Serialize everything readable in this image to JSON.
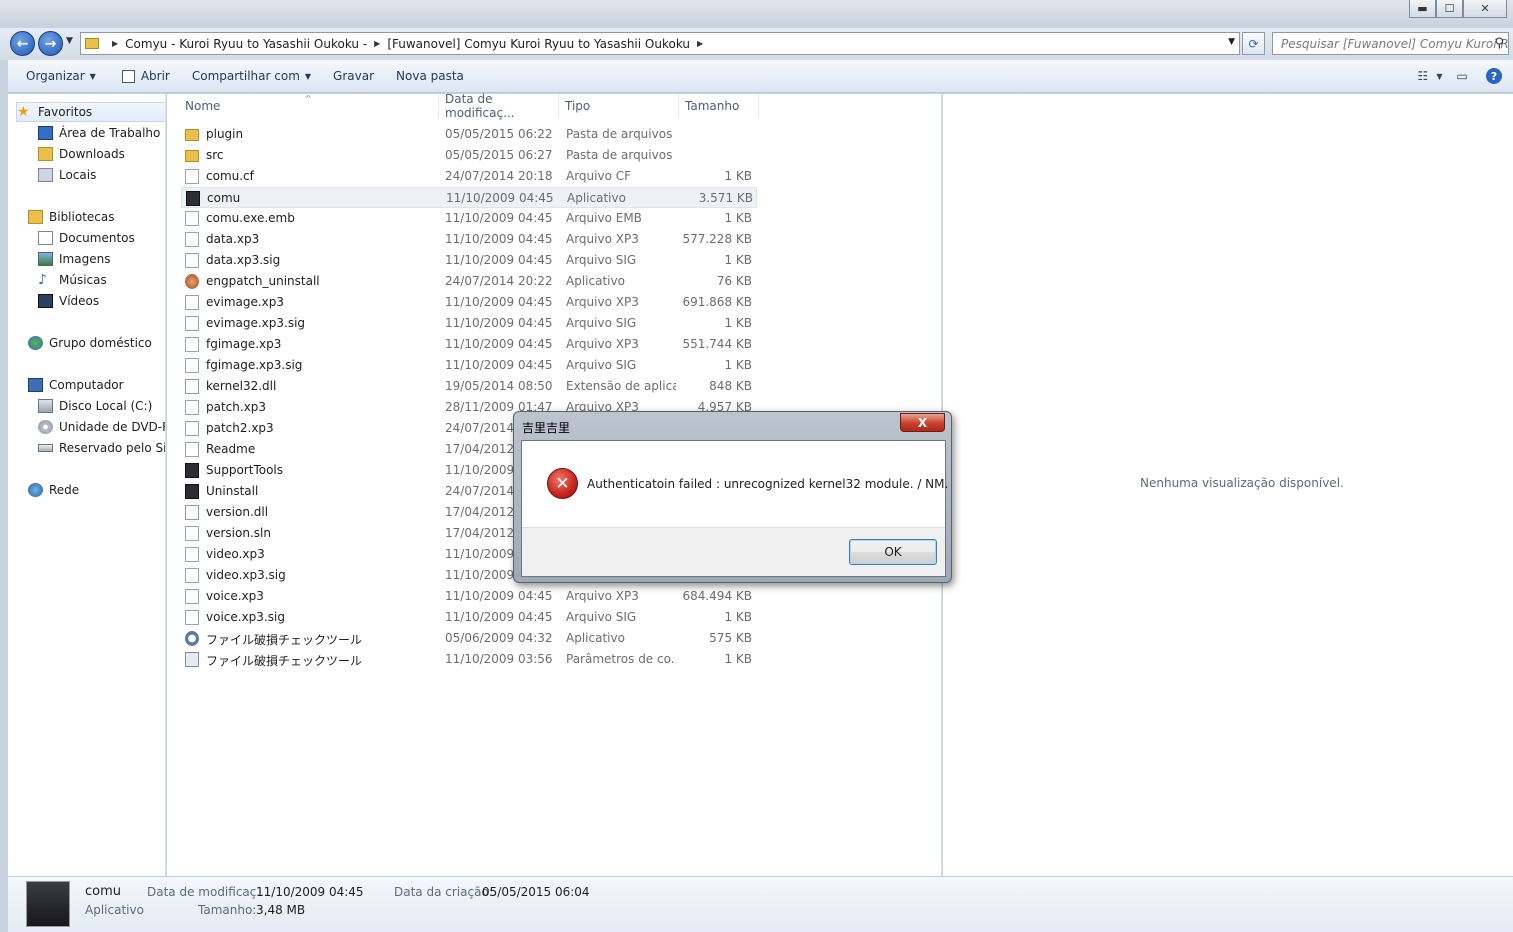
{
  "window": {
    "minimize": "▬",
    "maximize": "☐",
    "close": "✕"
  },
  "address": {
    "crumbs": [
      "Comyu - Kuroi Ryuu to Yasashii Oukoku -",
      "[Fuwanovel] Comyu Kuroi Ryuu to Yasashii Oukoku"
    ],
    "search_placeholder": "Pesquisar [Fuwanovel] Comyu Kuroi R..."
  },
  "toolbar": {
    "organize": "Organizar",
    "open": "Abrir",
    "share": "Compartilhar com",
    "burn": "Gravar",
    "new_folder": "Nova pasta"
  },
  "nav": {
    "favorites": "Favoritos",
    "desktop": "Área de Trabalho",
    "downloads": "Downloads",
    "places": "Locais",
    "libraries": "Bibliotecas",
    "documents": "Documentos",
    "images": "Imagens",
    "music": "Músicas",
    "videos": "Vídeos",
    "homegroup": "Grupo doméstico",
    "computer": "Computador",
    "disk_c": "Disco Local (C:)",
    "dvd": "Unidade de DVD-RW",
    "reserved": "Reservado pelo Sistema",
    "network": "Rede"
  },
  "columns": {
    "name": "Nome",
    "date": "Data de modificaç...",
    "type": "Tipo",
    "size": "Tamanho"
  },
  "files": [
    {
      "name": "plugin",
      "date": "05/05/2015 06:22",
      "type": "Pasta de arquivos",
      "size": "",
      "icon": "folder-icon"
    },
    {
      "name": "src",
      "date": "05/05/2015 06:27",
      "type": "Pasta de arquivos",
      "size": "",
      "icon": "folder-icon"
    },
    {
      "name": "comu.cf",
      "date": "24/07/2014 20:18",
      "type": "Arquivo CF",
      "size": "1 KB",
      "icon": "file-icon"
    },
    {
      "name": "comu",
      "date": "11/10/2009 04:45",
      "type": "Aplicativo",
      "size": "3.571 KB",
      "icon": "app-icon"
    },
    {
      "name": "comu.exe.emb",
      "date": "11/10/2009 04:45",
      "type": "Arquivo EMB",
      "size": "1 KB",
      "icon": "file-icon"
    },
    {
      "name": "data.xp3",
      "date": "11/10/2009 04:45",
      "type": "Arquivo XP3",
      "size": "577.228 KB",
      "icon": "file-icon"
    },
    {
      "name": "data.xp3.sig",
      "date": "11/10/2009 04:45",
      "type": "Arquivo SIG",
      "size": "1 KB",
      "icon": "file-icon"
    },
    {
      "name": "engpatch_uninstall",
      "date": "24/07/2014 20:22",
      "type": "Aplicativo",
      "size": "76 KB",
      "icon": "installer-icon"
    },
    {
      "name": "evimage.xp3",
      "date": "11/10/2009 04:45",
      "type": "Arquivo XP3",
      "size": "691.868 KB",
      "icon": "file-icon"
    },
    {
      "name": "evimage.xp3.sig",
      "date": "11/10/2009 04:45",
      "type": "Arquivo SIG",
      "size": "1 KB",
      "icon": "file-icon"
    },
    {
      "name": "fgimage.xp3",
      "date": "11/10/2009 04:45",
      "type": "Arquivo XP3",
      "size": "551.744 KB",
      "icon": "file-icon"
    },
    {
      "name": "fgimage.xp3.sig",
      "date": "11/10/2009 04:45",
      "type": "Arquivo SIG",
      "size": "1 KB",
      "icon": "file-icon"
    },
    {
      "name": "kernel32.dll",
      "date": "19/05/2014 08:50",
      "type": "Extensão de aplica...",
      "size": "848 KB",
      "icon": "dll-icon"
    },
    {
      "name": "patch.xp3",
      "date": "28/11/2009 01:47",
      "type": "Arquivo XP3",
      "size": "4.957 KB",
      "icon": "file-icon"
    },
    {
      "name": "patch2.xp3",
      "date": "24/07/2014 2",
      "type": "",
      "size": "",
      "icon": "file-icon"
    },
    {
      "name": "Readme",
      "date": "17/04/2012 2",
      "type": "",
      "size": "",
      "icon": "file-icon"
    },
    {
      "name": "SupportTools",
      "date": "11/10/2009 0",
      "type": "",
      "size": "",
      "icon": "app-icon"
    },
    {
      "name": "Uninstall",
      "date": "24/07/2014 2",
      "type": "",
      "size": "",
      "icon": "app-icon"
    },
    {
      "name": "version.dll",
      "date": "17/04/2012 2",
      "type": "",
      "size": "",
      "icon": "dll-icon"
    },
    {
      "name": "version.sln",
      "date": "17/04/2012 2",
      "type": "",
      "size": "",
      "icon": "file-icon"
    },
    {
      "name": "video.xp3",
      "date": "11/10/2009 0",
      "type": "",
      "size": "",
      "icon": "file-icon"
    },
    {
      "name": "video.xp3.sig",
      "date": "11/10/2009 0",
      "type": "",
      "size": "",
      "icon": "file-icon"
    },
    {
      "name": "voice.xp3",
      "date": "11/10/2009 04:45",
      "type": "Arquivo XP3",
      "size": "684.494 KB",
      "icon": "file-icon"
    },
    {
      "name": "voice.xp3.sig",
      "date": "11/10/2009 04:45",
      "type": "Arquivo SIG",
      "size": "1 KB",
      "icon": "file-icon"
    },
    {
      "name": "ファイル破損チェックツール",
      "date": "05/06/2009 04:32",
      "type": "Aplicativo",
      "size": "575 KB",
      "icon": "magnifier-icon"
    },
    {
      "name": "ファイル破損チェックツール",
      "date": "11/10/2009 03:56",
      "type": "Parâmetros de co...",
      "size": "1 KB",
      "icon": "settings-file-icon"
    }
  ],
  "preview": {
    "message": "Nenhuma visualização disponível."
  },
  "details": {
    "name": "comu",
    "kind": "Aplicativo",
    "modified_label": "Data de modificaç...",
    "modified_value": "11/10/2009 04:45",
    "size_label": "Tamanho:",
    "size_value": "3,48 MB",
    "created_label": "Data da criação:",
    "created_value": "05/05/2015 06:04"
  },
  "dialog": {
    "title": "吉里吉里",
    "close": "X",
    "message": "Authenticatoin failed : unrecognized kernel32 module. / NM.",
    "ok": "OK"
  }
}
